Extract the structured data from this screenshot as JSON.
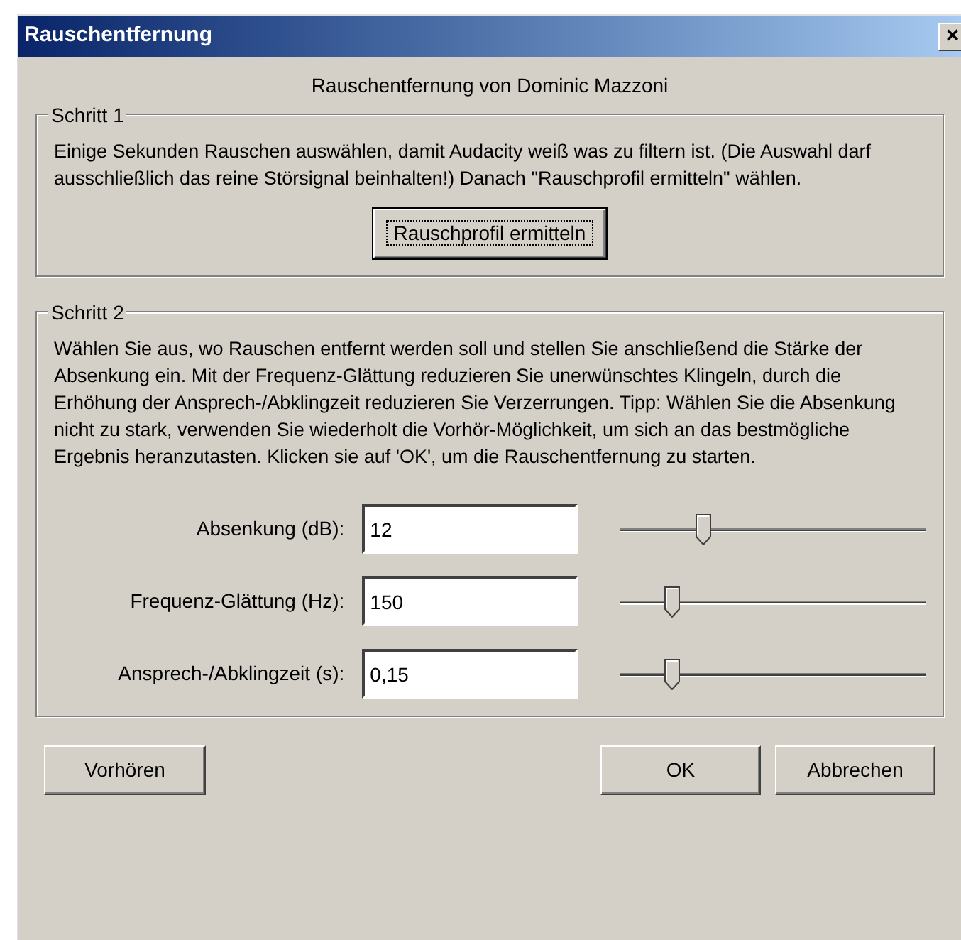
{
  "window": {
    "title": "Rauschentfernung",
    "close": "×"
  },
  "credit": "Rauschentfernung von Dominic Mazzoni",
  "step1": {
    "title": "Schritt 1",
    "text": "Einige Sekunden Rauschen auswählen, damit Audacity weiß was zu filtern ist. (Die Auswahl darf ausschließlich das reine Störsignal beinhalten!) Danach \"Rauschprofil ermitteln\" wählen.",
    "button": "Rauschprofil ermitteln"
  },
  "step2": {
    "title": "Schritt 2",
    "text": "Wählen Sie aus, wo Rauschen entfernt werden soll und stellen Sie anschließend die Stärke der Absenkung ein. Mit der Frequenz-Glättung reduzieren Sie unerwünschtes Klingeln, durch die Erhöhung der Ansprech-/Abklingzeit reduzieren Sie Verzerrungen. Tipp: Wählen Sie die Absenkung nicht zu stark, verwenden Sie wiederholt die Vorhör-Möglichkeit, um sich an das bestmögliche Ergebnis heranzutasten. Klicken sie auf 'OK', um die Rauschentfernung zu starten.",
    "params": [
      {
        "label": "Absenkung (dB):",
        "value": "12",
        "level": 0.27
      },
      {
        "label": "Frequenz-Glättung (Hz):",
        "value": "150",
        "level": 0.17
      },
      {
        "label": "Ansprech-/Abklingzeit (s):",
        "value": "0,15",
        "level": 0.17
      }
    ]
  },
  "buttons": {
    "preview": "Vorhören",
    "ok": "OK",
    "cancel": "Abbrechen"
  }
}
